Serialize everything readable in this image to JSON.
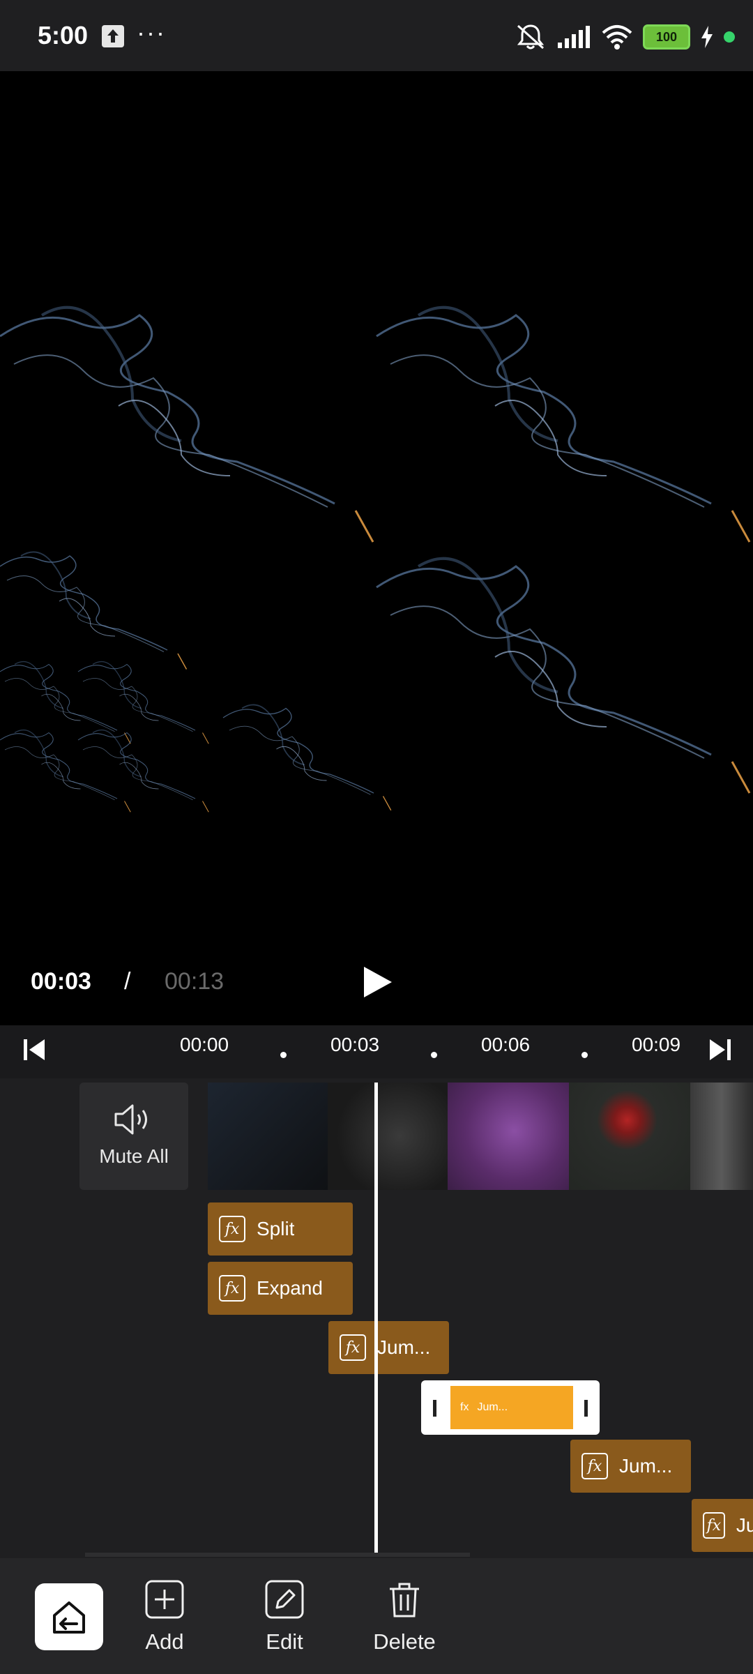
{
  "status": {
    "time": "5:00",
    "battery": "100",
    "icons": [
      "upload-icon",
      "more-icon",
      "mute-icon",
      "signal-icon",
      "wifi-icon",
      "battery-icon",
      "charging-icon"
    ]
  },
  "player": {
    "current_time": "00:03",
    "separator": "/",
    "total_time": "00:13"
  },
  "ruler": {
    "ticks": [
      "00:00",
      "00:03",
      "00:06",
      "00:09"
    ]
  },
  "audio": {
    "mute_label": "Mute All"
  },
  "effects": [
    {
      "label": "Split"
    },
    {
      "label": "Expand"
    },
    {
      "label": "Jum..."
    },
    {
      "label": "Jum..."
    },
    {
      "label": "Jum..."
    },
    {
      "label": "Ju"
    }
  ],
  "toolbar": {
    "add_label": "Add",
    "edit_label": "Edit",
    "delete_label": "Delete"
  },
  "colors": {
    "effect_clip": "#8a5a1c",
    "effect_selected": "#f5a623",
    "background": "#1f1f21"
  }
}
